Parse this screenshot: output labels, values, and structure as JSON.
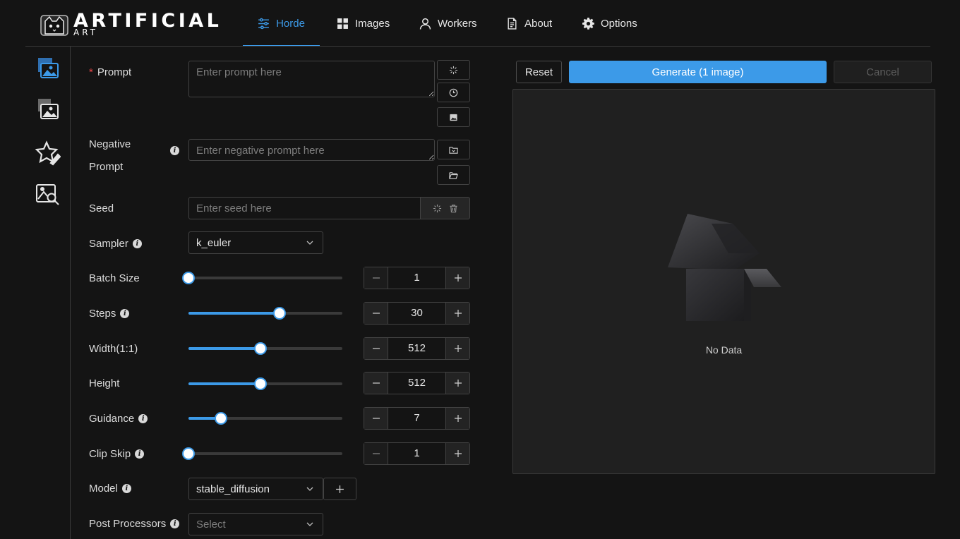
{
  "app": {
    "logo_main": "ARTIFICIAL",
    "logo_sub": "ART"
  },
  "nav": {
    "tabs": [
      {
        "label": "Horde",
        "icon": "sliders-icon",
        "active": true
      },
      {
        "label": "Images",
        "icon": "grid-icon"
      },
      {
        "label": "Workers",
        "icon": "user-icon"
      },
      {
        "label": "About",
        "icon": "document-icon"
      },
      {
        "label": "Options",
        "icon": "gear-icon"
      }
    ]
  },
  "sidebar": {
    "items": [
      {
        "icon": "generate-image-icon",
        "active": true
      },
      {
        "icon": "images-icon"
      },
      {
        "icon": "star-edit-icon"
      },
      {
        "icon": "image-search-icon"
      }
    ]
  },
  "form": {
    "prompt": {
      "required_mark": "*",
      "label": "Prompt",
      "placeholder": "Enter prompt here",
      "value": ""
    },
    "negative_prompt": {
      "label_line1": "Negative",
      "label_line2": "Prompt",
      "placeholder": "Enter negative prompt here",
      "value": ""
    },
    "seed": {
      "label": "Seed",
      "placeholder": "Enter seed here",
      "value": ""
    },
    "sampler": {
      "label": "Sampler",
      "value": "k_euler"
    },
    "batch_size": {
      "label": "Batch Size",
      "value": "1",
      "fraction": 0.0
    },
    "steps": {
      "label": "Steps",
      "value": "30",
      "fraction": 0.59
    },
    "width": {
      "label": "Width(1:1)",
      "value": "512",
      "fraction": 0.47
    },
    "height": {
      "label": "Height",
      "value": "512",
      "fraction": 0.47
    },
    "guidance": {
      "label": "Guidance",
      "value": "7",
      "fraction": 0.21
    },
    "clip_skip": {
      "label": "Clip Skip",
      "value": "1",
      "fraction": 0.0
    },
    "model": {
      "label": "Model",
      "value": "stable_diffusion"
    },
    "post_processors": {
      "label": "Post Processors",
      "placeholder": "Select"
    }
  },
  "actions": {
    "reset": "Reset",
    "generate": "Generate (1 image)",
    "cancel": "Cancel"
  },
  "result": {
    "empty_text": "No Data"
  },
  "colors": {
    "accent": "#3c9ae8",
    "background": "#141414",
    "panel": "#202020",
    "required": "#e84749"
  }
}
